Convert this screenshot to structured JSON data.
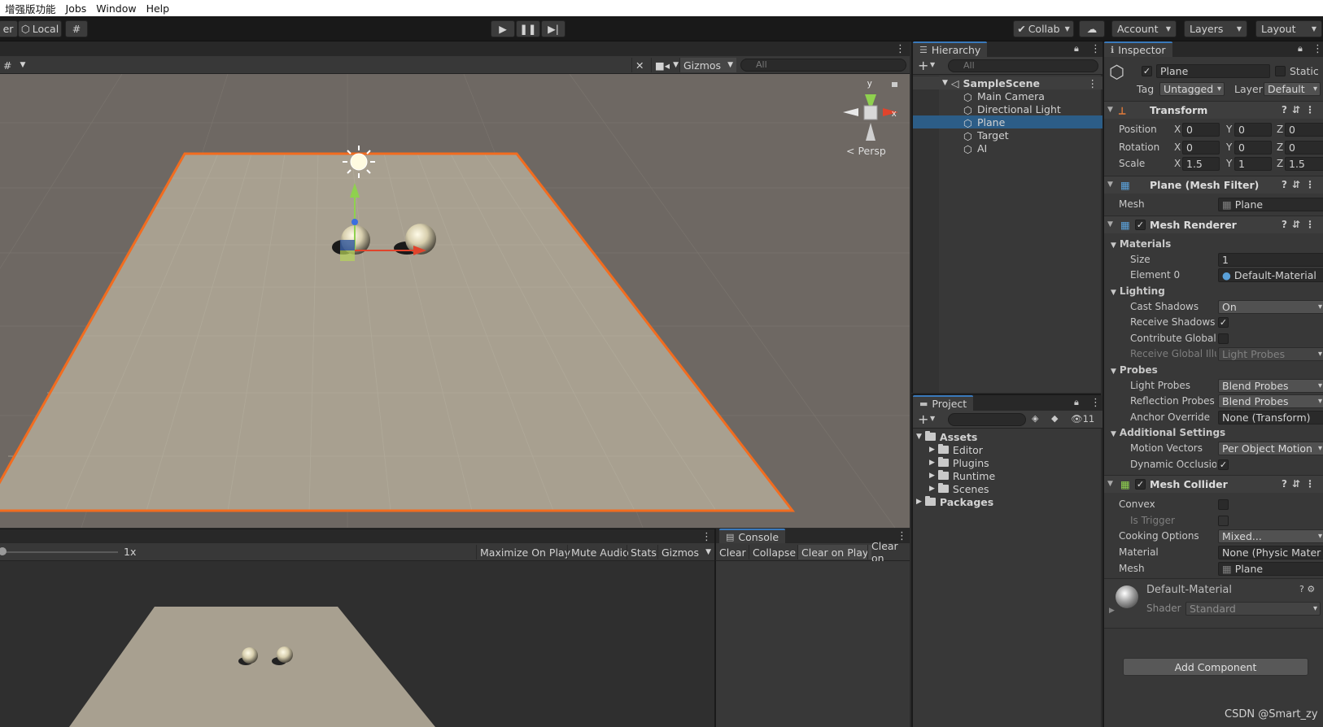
{
  "menu": {
    "items": [
      "增强版功能",
      "Jobs",
      "Window",
      "Help"
    ]
  },
  "toolbar": {
    "pivot_fragment": "er",
    "local_label": "Local",
    "collab_label": "Collab",
    "account_label": "Account",
    "layers_label": "Layers",
    "layout_label": "Layout"
  },
  "scene": {
    "gizmos_label": "Gizmos",
    "search_placeholder": "All",
    "persp_label": "< Persp",
    "axis_x": "x",
    "axis_y": "y"
  },
  "game": {
    "scale_label": "1x",
    "maximize_label": "Maximize On Play",
    "mute_label": "Mute Audio",
    "stats_label": "Stats",
    "gizmos_label": "Gizmos"
  },
  "console": {
    "tab_label": "Console",
    "clear_label": "Clear",
    "collapse_label": "Collapse",
    "clear_on_play_label": "Clear on Play",
    "clear_on_label": "Clear on"
  },
  "hierarchy": {
    "tab_label": "Hierarchy",
    "search_placeholder": "All",
    "scene_name": "SampleScene",
    "items": [
      "Main Camera",
      "Directional Light",
      "Plane",
      "Target",
      "AI"
    ],
    "selected": "Plane"
  },
  "project": {
    "tab_label": "Project",
    "hidden_count": "11",
    "assets_label": "Assets",
    "folders": [
      "Editor",
      "Plugins",
      "Runtime",
      "Scenes"
    ],
    "packages_label": "Packages"
  },
  "inspector": {
    "tab_label": "Inspector",
    "object_name": "Plane",
    "static_label": "Static",
    "tag_label": "Tag",
    "tag_value": "Untagged",
    "layer_label": "Layer",
    "layer_value": "Default",
    "transform": {
      "title": "Transform",
      "position_label": "Position",
      "position": [
        "0",
        "0",
        "0"
      ],
      "rotation_label": "Rotation",
      "rotation": [
        "0",
        "0",
        "0"
      ],
      "scale_label": "Scale",
      "scale": [
        "1.5",
        "1",
        "1.5"
      ]
    },
    "mesh_filter": {
      "title": "Plane (Mesh Filter)",
      "mesh_label": "Mesh",
      "mesh_value": "Plane"
    },
    "mesh_renderer": {
      "title": "Mesh Renderer",
      "materials_label": "Materials",
      "size_label": "Size",
      "size_value": "1",
      "element0_label": "Element 0",
      "element0_value": "Default-Material",
      "lighting_label": "Lighting",
      "cast_shadows_label": "Cast Shadows",
      "cast_shadows_value": "On",
      "receive_shadows_label": "Receive Shadows",
      "contribute_gi_label": "Contribute Global I",
      "receive_gi_label": "Receive Global Illu",
      "receive_gi_value": "Light Probes",
      "probes_label": "Probes",
      "light_probes_label": "Light Probes",
      "light_probes_value": "Blend Probes",
      "reflection_probes_label": "Reflection Probes",
      "reflection_probes_value": "Blend Probes",
      "anchor_label": "Anchor Override",
      "anchor_value": "None (Transform)",
      "additional_label": "Additional Settings",
      "motion_vectors_label": "Motion Vectors",
      "motion_vectors_value": "Per Object Motion",
      "dynamic_occlusion_label": "Dynamic Occlusio"
    },
    "mesh_collider": {
      "title": "Mesh Collider",
      "convex_label": "Convex",
      "trigger_label": "Is Trigger",
      "cooking_label": "Cooking Options",
      "cooking_value": "Mixed...",
      "material_label": "Material",
      "material_value": "None (Physic Mater",
      "mesh_label": "Mesh",
      "mesh_value": "Plane"
    },
    "material": {
      "name": "Default-Material",
      "shader_label": "Shader",
      "shader_value": "Standard"
    },
    "add_component_label": "Add Component"
  },
  "watermark": "CSDN @Smart_zy",
  "colors": {
    "selection": "#2c5d87",
    "outline": "#f26c1f",
    "plane": "#a8a090",
    "sky": "#6e6863"
  }
}
